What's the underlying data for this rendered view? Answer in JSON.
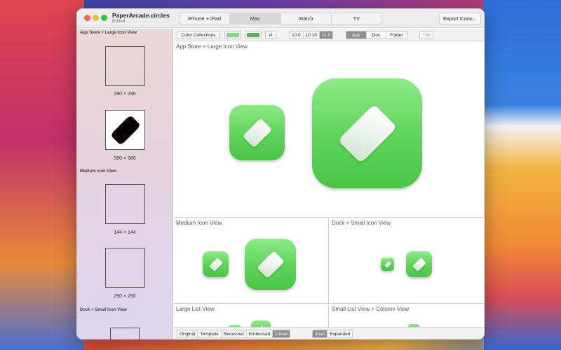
{
  "window": {
    "title": "PaperArcade.circles",
    "subtitle": "Edited",
    "tabs": [
      "iPhone + iPad",
      "Mac",
      "Watch",
      "TV"
    ],
    "active_tab": "Mac",
    "export_label": "Export Icons..."
  },
  "toolbar": {
    "color_collections": "Color Collections",
    "swatch_light": "#7edb79",
    "swatch_dark": "#4fb34d",
    "swap_glyph": "⇄",
    "versions": [
      "10.0",
      "10.15",
      "11.0"
    ],
    "active_version": "11.0",
    "kinds": [
      "App",
      "Doc",
      "Folder"
    ],
    "active_kind": "App",
    "title_button": "Title"
  },
  "sidebar": {
    "sections": {
      "app_store": "App Store + Large Icon View",
      "medium": "Medium Icon View",
      "dock_small": "Dock + Small Icon View"
    },
    "wells": [
      {
        "label": "290 × 290"
      },
      {
        "label": "580 × 580"
      },
      {
        "label": "144 × 144"
      },
      {
        "label": "290 × 290"
      }
    ]
  },
  "panels": {
    "app_store": "App Store + Large Icon View",
    "medium": "Medium Icon View",
    "dock_small": "Dock + Small Icon View",
    "large_list": "Large List View",
    "small_list": "Small List View + Column View"
  },
  "bottom": {
    "styles": [
      "Original",
      "Template",
      "Recessed",
      "Embossed",
      "Linear"
    ],
    "active_style": "Linear",
    "modes": [
      "Inset",
      "Expanded"
    ],
    "active_mode": "Inset"
  },
  "colors": {
    "icon_green": "#5ed35a",
    "gem_white": "#f4f8f4"
  }
}
